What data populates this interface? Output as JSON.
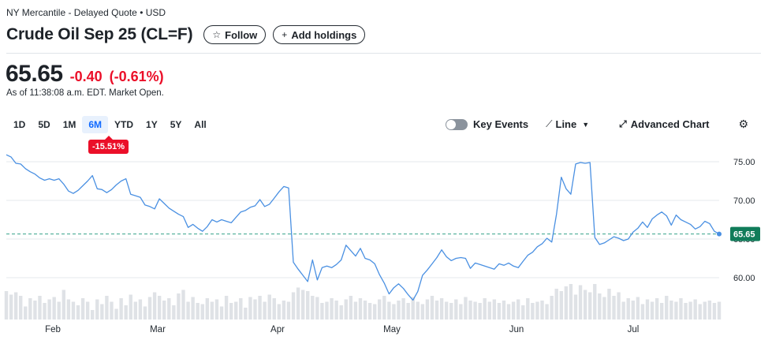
{
  "header": {
    "exchange": "NY Mercantile - Delayed Quote • USD",
    "title": "Crude Oil Sep 25 (CL=F)",
    "follow_label": "Follow",
    "follow_icon": "star-icon",
    "add_holdings_label": "Add holdings",
    "add_icon": "plus-icon"
  },
  "quote": {
    "price": "65.65",
    "change": "-0.40",
    "change_pct": "(-0.61%)",
    "as_of": "As of 11:38:08 a.m. EDT. Market Open.",
    "down_color": "#eb0f29"
  },
  "ranges": {
    "items": [
      "1D",
      "5D",
      "1M",
      "6M",
      "YTD",
      "1Y",
      "5Y",
      "All"
    ],
    "active": "6M",
    "active_change": "-15.51%"
  },
  "toolbar": {
    "key_events_label": "Key Events",
    "key_events_on": false,
    "chart_type_label": "Line",
    "advanced_label": "Advanced Chart",
    "settings_icon": "gear-icon"
  },
  "chart_data": {
    "type": "line",
    "x_labels": [
      "Feb",
      "Mar",
      "Apr",
      "May",
      "Jun",
      "Jul"
    ],
    "y_ticks": [
      60.0,
      65.0,
      70.0,
      75.0
    ],
    "y_tick_labels": [
      "60.00",
      "65.00",
      "70.00",
      "75.00"
    ],
    "ylim": [
      57.5,
      77.5
    ],
    "last_price_label": "65.65",
    "reference_price": 65.65,
    "line_color": "#4a90e2",
    "grid": true,
    "values": [
      75.9,
      75.6,
      74.8,
      74.7,
      74.1,
      73.7,
      73.4,
      72.9,
      72.6,
      72.8,
      72.6,
      72.8,
      72.1,
      71.2,
      70.9,
      71.3,
      71.9,
      72.5,
      73.2,
      71.5,
      71.4,
      71.0,
      71.4,
      72.0,
      72.5,
      72.8,
      70.8,
      70.6,
      70.4,
      69.4,
      69.2,
      68.9,
      70.2,
      69.6,
      69.0,
      68.6,
      68.2,
      67.9,
      66.5,
      66.9,
      66.4,
      66.0,
      66.6,
      67.5,
      67.2,
      67.5,
      67.3,
      67.1,
      67.8,
      68.5,
      68.7,
      69.1,
      69.3,
      70.1,
      69.2,
      69.5,
      70.3,
      71.1,
      71.8,
      71.6,
      62.0,
      61.1,
      60.3,
      59.5,
      62.3,
      59.7,
      61.3,
      61.5,
      61.3,
      61.7,
      62.3,
      64.2,
      63.5,
      62.8,
      63.8,
      62.5,
      62.3,
      61.8,
      60.4,
      59.3,
      57.9,
      58.7,
      59.2,
      58.6,
      57.8,
      57.1,
      58.2,
      60.3,
      61.0,
      61.8,
      62.6,
      63.6,
      62.7,
      62.2,
      62.5,
      62.6,
      62.5,
      61.2,
      61.9,
      61.7,
      61.5,
      61.3,
      61.1,
      61.8,
      61.6,
      61.9,
      61.5,
      61.3,
      62.1,
      62.9,
      63.3,
      64.0,
      64.4,
      65.1,
      64.6,
      68.2,
      73.0,
      71.5,
      70.8,
      74.7,
      74.9,
      74.8,
      74.9,
      65.2,
      64.3,
      64.5,
      64.9,
      65.3,
      65.1,
      64.8,
      65.0,
      65.9,
      66.4,
      67.2,
      66.5,
      67.6,
      68.1,
      68.5,
      68.0,
      66.8,
      68.1,
      67.5,
      67.2,
      66.9,
      66.3,
      66.6,
      67.3,
      67.0,
      66.0,
      65.65
    ],
    "volumes": [
      0.48,
      0.42,
      0.46,
      0.4,
      0.22,
      0.36,
      0.32,
      0.4,
      0.28,
      0.34,
      0.38,
      0.3,
      0.5,
      0.34,
      0.3,
      0.24,
      0.36,
      0.3,
      0.16,
      0.34,
      0.26,
      0.4,
      0.3,
      0.18,
      0.36,
      0.24,
      0.42,
      0.3,
      0.34,
      0.22,
      0.38,
      0.46,
      0.4,
      0.32,
      0.36,
      0.24,
      0.44,
      0.5,
      0.3,
      0.38,
      0.28,
      0.26,
      0.36,
      0.3,
      0.34,
      0.22,
      0.4,
      0.28,
      0.3,
      0.36,
      0.2,
      0.38,
      0.34,
      0.4,
      0.3,
      0.42,
      0.36,
      0.26,
      0.32,
      0.3,
      0.46,
      0.54,
      0.5,
      0.48,
      0.4,
      0.38,
      0.28,
      0.3,
      0.36,
      0.32,
      0.24,
      0.34,
      0.4,
      0.3,
      0.36,
      0.32,
      0.28,
      0.26,
      0.34,
      0.4,
      0.3,
      0.26,
      0.32,
      0.36,
      0.28,
      0.38,
      0.3,
      0.26,
      0.34,
      0.4,
      0.32,
      0.36,
      0.3,
      0.28,
      0.34,
      0.26,
      0.38,
      0.32,
      0.3,
      0.28,
      0.36,
      0.3,
      0.34,
      0.28,
      0.32,
      0.26,
      0.3,
      0.34,
      0.24,
      0.36,
      0.28,
      0.3,
      0.32,
      0.26,
      0.4,
      0.52,
      0.48,
      0.56,
      0.6,
      0.42,
      0.58,
      0.5,
      0.46,
      0.6,
      0.44,
      0.38,
      0.52,
      0.4,
      0.46,
      0.3,
      0.36,
      0.32,
      0.38,
      0.26,
      0.34,
      0.3,
      0.36,
      0.28,
      0.4,
      0.32,
      0.3,
      0.36,
      0.28,
      0.3,
      0.34,
      0.26,
      0.3,
      0.32,
      0.28,
      0.3
    ]
  }
}
